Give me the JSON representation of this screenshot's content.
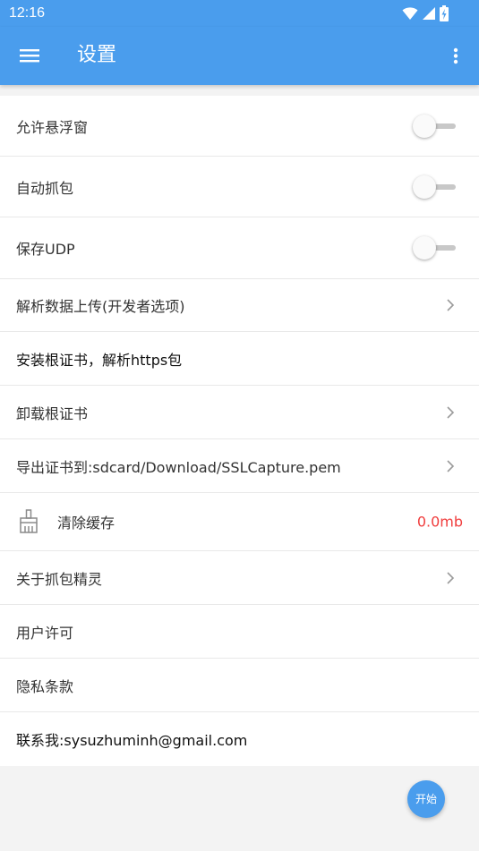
{
  "status_bar": {
    "time": "12:16",
    "icons": [
      "wifi-icon",
      "signal-icon",
      "battery-charging-icon"
    ]
  },
  "app_bar": {
    "title": "设置",
    "menu_icon": "hamburger-menu-icon",
    "more_icon": "more-vert-icon"
  },
  "settings": [
    {
      "label": "允许悬浮窗",
      "type": "switch",
      "on": false
    },
    {
      "label": "自动抓包",
      "type": "switch",
      "on": false
    },
    {
      "label": "保存UDP",
      "type": "switch",
      "on": false
    },
    {
      "label": "解析数据上传(开发者选项)",
      "type": "chevron"
    },
    {
      "label": "安装根证书，解析https包",
      "type": "plain"
    },
    {
      "label": "卸载根证书",
      "type": "chevron"
    },
    {
      "label": "导出证书到:sdcard/Download/SSLCapture.pem",
      "type": "chevron"
    },
    {
      "label": "清除缓存",
      "type": "value",
      "value": "0.0mb",
      "icon": "broom-icon"
    },
    {
      "label": "关于抓包精灵",
      "type": "chevron"
    },
    {
      "label": "用户许可",
      "type": "plain"
    },
    {
      "label": "隐私条款",
      "type": "plain"
    },
    {
      "label": "联系我:sysuzhuminh@gmail.com",
      "type": "plain"
    }
  ],
  "fab": {
    "label": "开始"
  },
  "colors": {
    "primary": "#4a9ded",
    "accent_value": "#f03d3d",
    "background": "#f3f3f3"
  }
}
